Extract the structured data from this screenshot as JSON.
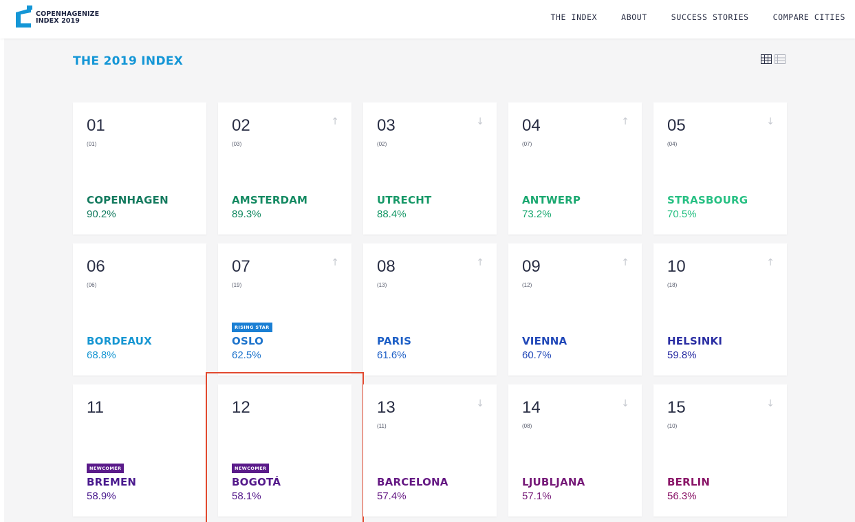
{
  "header": {
    "logo_line1": "COPENHAGENIZE",
    "logo_line2": "INDEX 2019",
    "nav": [
      "THE INDEX",
      "ABOUT",
      "SUCCESS STORIES",
      "COMPARE CITIES"
    ]
  },
  "page": {
    "title": "THE 2019 INDEX",
    "view_toggle": [
      "grid-view-icon",
      "list-view-icon"
    ]
  },
  "colors": {
    "title": "#1496d6",
    "selection_outline": "#e2492f",
    "rising_star_badge": "#1a7fd4",
    "newcomer_badge": "#5a1a8a"
  },
  "cities": [
    {
      "rank": "01",
      "previous": "(01)",
      "trend": "",
      "badge": "",
      "name": "COPENHAGEN",
      "score": "90.2%",
      "color": "#137a5e"
    },
    {
      "rank": "02",
      "previous": "(03)",
      "trend": "up",
      "badge": "",
      "name": "AMSTERDAM",
      "score": "89.3%",
      "color": "#148a62"
    },
    {
      "rank": "03",
      "previous": "(02)",
      "trend": "down",
      "badge": "",
      "name": "UTRECHT",
      "score": "88.4%",
      "color": "#169867"
    },
    {
      "rank": "04",
      "previous": "(07)",
      "trend": "up",
      "badge": "",
      "name": "ANTWERP",
      "score": "73.2%",
      "color": "#1aa870"
    },
    {
      "rank": "05",
      "previous": "(04)",
      "trend": "down",
      "badge": "",
      "name": "STRASBOURG",
      "score": "70.5%",
      "color": "#27c083"
    },
    {
      "rank": "06",
      "previous": "(06)",
      "trend": "",
      "badge": "",
      "name": "BORDEAUX",
      "score": "68.8%",
      "color": "#1696d2"
    },
    {
      "rank": "07",
      "previous": "(19)",
      "trend": "up",
      "badge": "RISING STAR",
      "name": "OSLO",
      "score": "62.5%",
      "color": "#1e74cc"
    },
    {
      "rank": "08",
      "previous": "(13)",
      "trend": "up",
      "badge": "",
      "name": "PARIS",
      "score": "61.6%",
      "color": "#1d5fc6"
    },
    {
      "rank": "09",
      "previous": "(12)",
      "trend": "up",
      "badge": "",
      "name": "VIENNA",
      "score": "60.7%",
      "color": "#2148b8"
    },
    {
      "rank": "10",
      "previous": "(18)",
      "trend": "up",
      "badge": "",
      "name": "HELSINKI",
      "score": "59.8%",
      "color": "#2a2ea3"
    },
    {
      "rank": "11",
      "previous": "",
      "trend": "",
      "badge": "NEWCOMER",
      "name": "BREMEN",
      "score": "58.9%",
      "color": "#4a1a8e"
    },
    {
      "rank": "12",
      "previous": "",
      "trend": "",
      "badge": "NEWCOMER",
      "name": "BOGOTÁ",
      "score": "58.1%",
      "color": "#551a8b",
      "selected": true
    },
    {
      "rank": "13",
      "previous": "(11)",
      "trend": "down",
      "badge": "",
      "name": "BARCELONA",
      "score": "57.4%",
      "color": "#661a84"
    },
    {
      "rank": "14",
      "previous": "(08)",
      "trend": "down",
      "badge": "",
      "name": "LJUBLJANA",
      "score": "57.1%",
      "color": "#761a78"
    },
    {
      "rank": "15",
      "previous": "(10)",
      "trend": "down",
      "badge": "",
      "name": "BERLIN",
      "score": "56.3%",
      "color": "#8a1668"
    }
  ]
}
